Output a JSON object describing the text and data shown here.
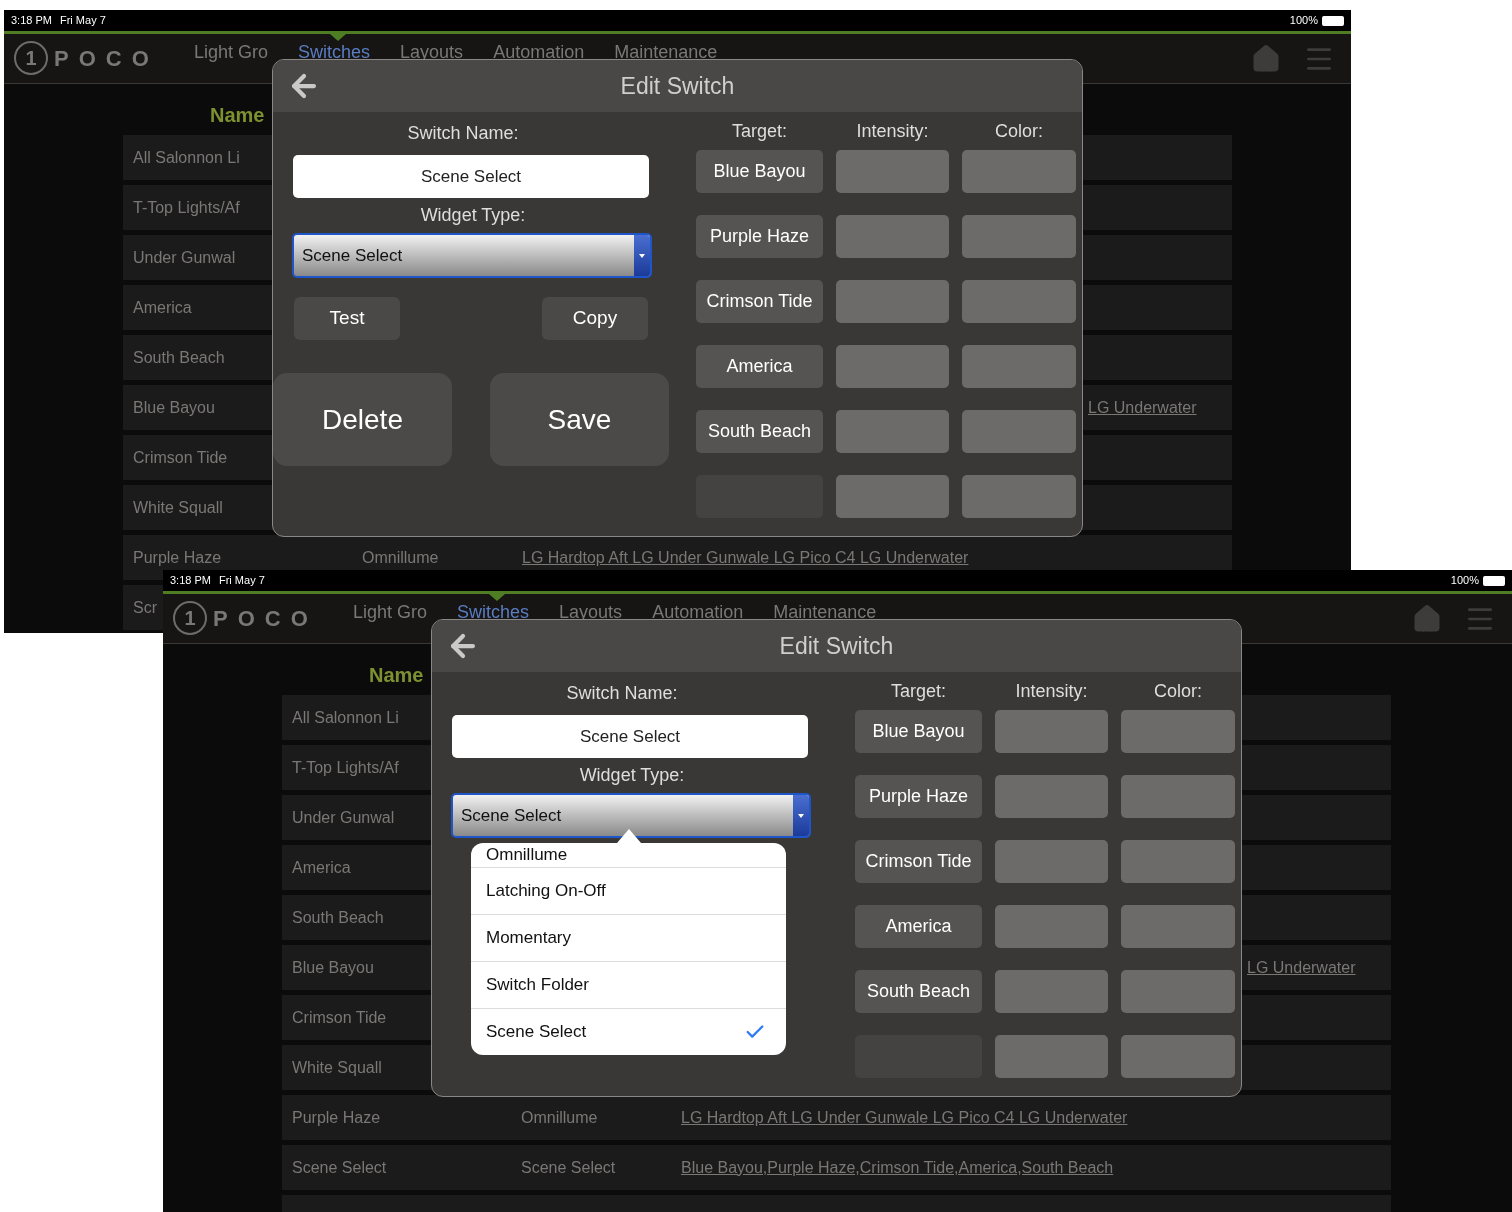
{
  "screens": [
    {
      "status_bar": {
        "time": "3:18 PM",
        "date": "Fri May 7",
        "battery": "100%"
      },
      "nav": {
        "logo_mark": "1",
        "logo_text": "POCO",
        "items": [
          {
            "label": "Light Gro",
            "selected": false
          },
          {
            "label": "Switches",
            "selected": true
          },
          {
            "label": "Layouts",
            "selected": false
          },
          {
            "label": "Automation",
            "selected": false
          },
          {
            "label": "Maintenance",
            "selected": false
          }
        ]
      },
      "table": {
        "column_header": "Name",
        "rows": [
          {
            "kind": "data",
            "name": "All Salonnon Li"
          },
          {
            "kind": "data",
            "name": "T-Top Lights/Af"
          },
          {
            "kind": "data",
            "name": "Under Gunwal"
          },
          {
            "kind": "data",
            "name": "America"
          },
          {
            "kind": "data",
            "name": "South Beach"
          },
          {
            "kind": "data",
            "name": "Blue Bayou",
            "column_4": "LG Underwater"
          },
          {
            "kind": "data",
            "name": "Crimson Tide"
          },
          {
            "kind": "data",
            "name": "White Squall"
          },
          {
            "kind": "data",
            "name": "Purple Haze",
            "type": "Omnillume",
            "targets": "LG Hardtop Aft LG Under Gunwale LG Pico C4 LG Underwater"
          },
          {
            "kind": "data",
            "name": "Scr"
          }
        ]
      },
      "dialog": {
        "title": "Edit Switch",
        "switch_name_label": "Switch Name:",
        "switch_name": "Scene Select",
        "widget_type_label": "Widget Type:",
        "widget_type": "Scene Select",
        "buttons": [
          {
            "label": "Test",
            "kind": "small"
          },
          {
            "label": "Copy",
            "kind": "small"
          },
          {
            "label": "Delete",
            "kind": "large"
          },
          {
            "label": "Save",
            "kind": "large"
          }
        ],
        "grid_headers": [
          "Target:",
          "Intensity:",
          "Color:"
        ],
        "targets": [
          {
            "kind": "named",
            "label": "Blue Bayou"
          },
          {
            "kind": "named",
            "label": "Purple Haze"
          },
          {
            "kind": "named",
            "label": "Crimson Tide"
          },
          {
            "kind": "named",
            "label": "America"
          },
          {
            "kind": "named",
            "label": "South Beach"
          },
          {
            "kind": "empty"
          }
        ]
      }
    },
    {
      "status_bar": {
        "time": "3:18 PM",
        "date": "Fri May 7",
        "battery": "100%"
      },
      "nav": {
        "logo_mark": "1",
        "logo_text": "POCO",
        "items": [
          {
            "label": "Light Gro",
            "selected": false
          },
          {
            "label": "Switches",
            "selected": true
          },
          {
            "label": "Layouts",
            "selected": false
          },
          {
            "label": "Automation",
            "selected": false
          },
          {
            "label": "Maintenance",
            "selected": false
          }
        ]
      },
      "table": {
        "column_header": "Name",
        "rows": [
          {
            "kind": "data",
            "name": "All Salonnon Li"
          },
          {
            "kind": "data",
            "name": "T-Top Lights/Af"
          },
          {
            "kind": "data",
            "name": "Under Gunwal"
          },
          {
            "kind": "data",
            "name": "America"
          },
          {
            "kind": "data",
            "name": "South Beach"
          },
          {
            "kind": "data",
            "name": "Blue Bayou",
            "column_4": "LG Underwater"
          },
          {
            "kind": "data",
            "name": "Crimson Tide"
          },
          {
            "kind": "data",
            "name": "White Squall"
          },
          {
            "kind": "data",
            "name": "Purple Haze",
            "type": "Omnillume",
            "targets": "LG Hardtop Aft LG Under Gunwale LG Pico C4 LG Underwater"
          },
          {
            "kind": "data",
            "name": "Scene Select",
            "type": "Scene Select",
            "targets": "Blue Bayou,Purple Haze,Crimson Tide,America,South Beach"
          },
          {
            "kind": "blank"
          }
        ]
      },
      "dialog": {
        "title": "Edit Switch",
        "switch_name_label": "Switch Name:",
        "switch_name": "Scene Select",
        "widget_type_label": "Widget Type:",
        "widget_type": "Scene Select",
        "grid_headers": [
          "Target:",
          "Intensity:",
          "Color:"
        ],
        "targets": [
          {
            "kind": "named",
            "label": "Blue Bayou"
          },
          {
            "kind": "named",
            "label": "Purple Haze"
          },
          {
            "kind": "named",
            "label": "Crimson Tide"
          },
          {
            "kind": "named",
            "label": "America"
          },
          {
            "kind": "named",
            "label": "South Beach"
          },
          {
            "kind": "empty"
          }
        ]
      },
      "dropdown": {
        "options": [
          {
            "label": "Omnillume",
            "selected": false
          },
          {
            "label": "Latching On-Off",
            "selected": false
          },
          {
            "label": "Momentary",
            "selected": false
          },
          {
            "label": "Switch Folder",
            "selected": false
          },
          {
            "label": "Scene Select",
            "selected": true
          }
        ]
      }
    }
  ]
}
